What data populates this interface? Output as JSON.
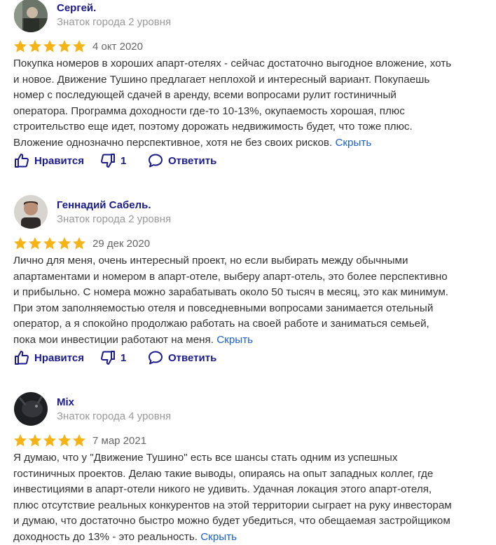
{
  "reviews": [
    {
      "name": "Сергей.",
      "level": "Знаток города 2 уровня",
      "rating": 5,
      "date": "4 окт 2020",
      "lines": [
        "Покупка номеров в хороших апарт-отелях - сейчас достаточно выгодное вложение, хоть",
        "и новое. Движение Тушино предлагает неплохой и интересный вариант. Покупаешь",
        "номер с последующей сдачей в аренду, всеми вопросами рулит гостиничный",
        "оператора. Программа доходности где-то 10-13%, окупаемость хорошая, плюс",
        "строительство еще идет, поэтому дорожать недвижимость будет, что тоже плюс.",
        "Вложение однозначно перспективное, хотя не без своих рисков."
      ],
      "hide": "Скрыть",
      "like": "Нравится",
      "dislike_count": "1",
      "reply": "Ответить"
    },
    {
      "name": "Геннадий Сабель.",
      "level": "Знаток города 2 уровня",
      "rating": 5,
      "date": "29 дек 2020",
      "lines": [
        "Лично для меня, очень интересный проект, но если выбирать между обычными",
        "апартаментами и номером в апарт-отеле, выберу апарт-отель, это более перспективно",
        "и прибыльно. С номера можно зарабатывать около 50 тысяч в месяц, это как минимум.",
        "При этом заполняемостью отеля и повседневными вопросами занимается отельный",
        "оператор, а я спокойно продолжаю работать на своей работе и заниматься семьей,",
        "пока мои инвестиции работают на меня."
      ],
      "hide": "Скрыть",
      "like": "Нравится",
      "dislike_count": "1",
      "reply": "Ответить"
    },
    {
      "name": "Mix",
      "level": "Знаток города 4 уровня",
      "rating": 5,
      "date": "7 мар 2021",
      "lines": [
        "Я думаю, что у \"Движение Тушино\" есть все шансы стать одним из успешных",
        "гостиничных проектов. Делаю такие выводы, опираясь на опыт западных коллег, где",
        "инвестициями в апарт-отели никого не удивить. Удачная локация этого апарт-отеля,",
        "плюс отсутствие реальных конкурентов на этой территории сыграет на руку инвесторам",
        "и думаю, что достаточно быстро можно будет убедиться, что обещаемая застройщиком",
        "доходность до 13% - это реальность."
      ],
      "hide": "Скрыть"
    }
  ],
  "colors": {
    "star": "#f5b316",
    "name": "#1a1a8c",
    "link": "#1a5fd1"
  },
  "icons": [
    "thumb-up-icon",
    "thumb-down-icon",
    "comment-bubble-icon",
    "star-icon"
  ]
}
